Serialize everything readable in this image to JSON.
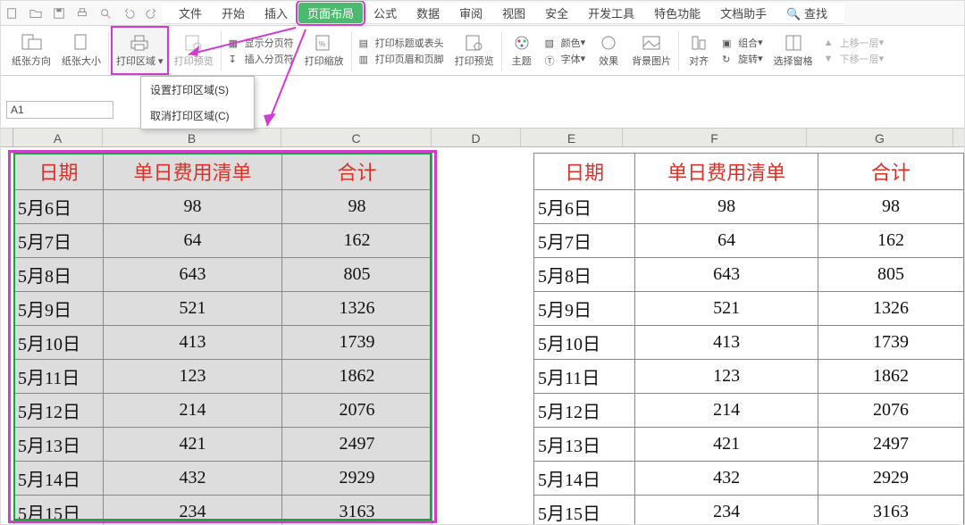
{
  "name_box": "A1",
  "qat": {
    "items": [
      "",
      "",
      "",
      "",
      "",
      "",
      ""
    ]
  },
  "menu": {
    "file": "文件",
    "home": "开始",
    "insert": "插入",
    "page_layout": "页面布局",
    "formulas": "公式",
    "data": "数据",
    "review": "审阅",
    "view": "视图",
    "security": "安全",
    "developer": "开发工具",
    "special": "特色功能",
    "doc_helper": "文档助手",
    "find": "查找"
  },
  "ribbon": {
    "paper_orient": "纸张方向",
    "paper_size": "纸张大小",
    "print_area": "打印区域",
    "print_preview": "打印预览",
    "show_breaks": "显示分页符",
    "insert_break": "插入分页符",
    "print_zoom": "打印缩放",
    "print_titles": "打印标题或表头",
    "header_footer": "打印页眉和页脚",
    "print_preview2": "打印预览",
    "theme": "主题",
    "colors": "颜色",
    "fonts": "字体",
    "effects": "效果",
    "bg_image": "背景图片",
    "align": "对齐",
    "group": "组合",
    "rotate": "旋转",
    "selection_pane": "选择窗格",
    "bring_forward": "上移一层",
    "send_backward": "下移一层"
  },
  "dropdown": {
    "set_print_area": "设置打印区域(S)",
    "cancel_print_area": "取消打印区域(C)"
  },
  "cols": {
    "A": "A",
    "B": "B",
    "C": "C",
    "D": "D",
    "E": "E",
    "F": "F",
    "G": "G"
  },
  "table": {
    "headers": {
      "date": "日期",
      "daily": "单日费用清单",
      "total": "合计"
    },
    "rows": [
      {
        "date": "5月6日",
        "daily": "98",
        "total": "98"
      },
      {
        "date": "5月7日",
        "daily": "64",
        "total": "162"
      },
      {
        "date": "5月8日",
        "daily": "643",
        "total": "805"
      },
      {
        "date": "5月9日",
        "daily": "521",
        "total": "1326"
      },
      {
        "date": "5月10日",
        "daily": "413",
        "total": "1739"
      },
      {
        "date": "5月11日",
        "daily": "123",
        "total": "1862"
      },
      {
        "date": "5月12日",
        "daily": "214",
        "total": "2076"
      },
      {
        "date": "5月13日",
        "daily": "421",
        "total": "2497"
      },
      {
        "date": "5月14日",
        "daily": "432",
        "total": "2929"
      },
      {
        "date": "5月15日",
        "daily": "234",
        "total": "3163"
      }
    ]
  }
}
